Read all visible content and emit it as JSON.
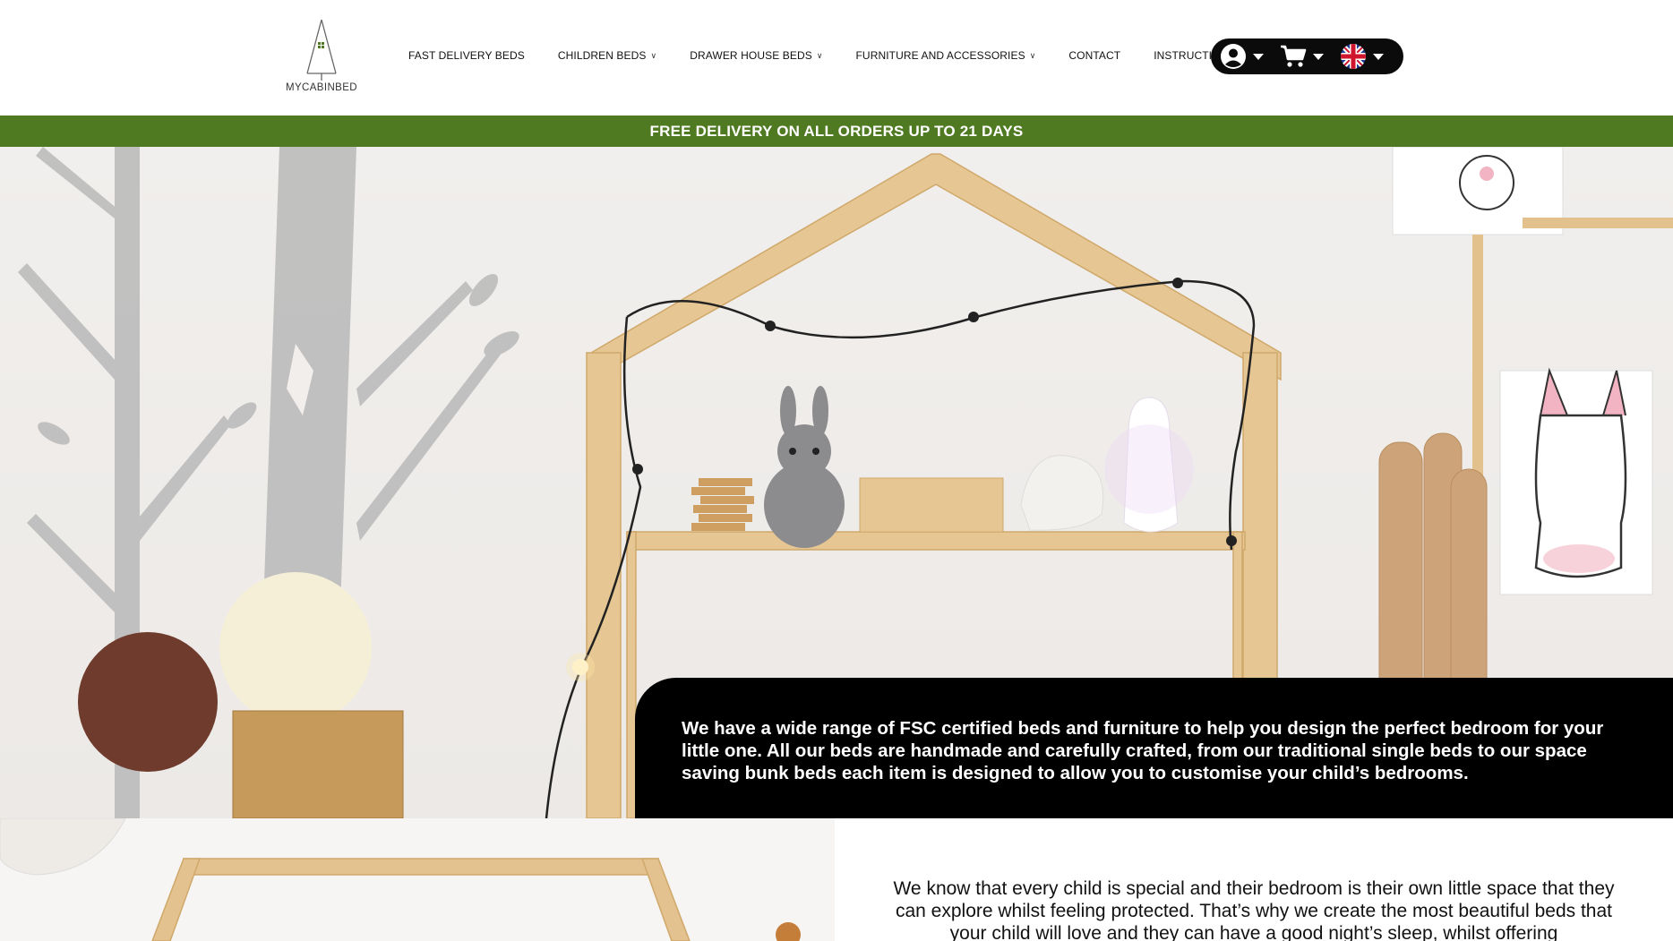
{
  "header": {
    "logo_text": "MYCABINBED",
    "nav": [
      {
        "label": "FAST DELIVERY BEDS",
        "has_dropdown": false
      },
      {
        "label": "CHILDREN BEDS",
        "has_dropdown": true
      },
      {
        "label": "DRAWER HOUSE BEDS",
        "has_dropdown": true
      },
      {
        "label": "FURNITURE AND ACCESSORIES",
        "has_dropdown": true
      },
      {
        "label": "CONTACT",
        "has_dropdown": false
      },
      {
        "label": "INSTRUCTIONS",
        "has_dropdown": false
      }
    ],
    "dropdown_caret": "∨",
    "account_icon": "user-circle-icon",
    "cart_icon": "shopping-cart-icon",
    "language_icon": "uk-flag-icon"
  },
  "promo": {
    "text": "FREE DELIVERY ON ALL ORDERS UP TO 21 DAYS",
    "background": "#4f7a22"
  },
  "hero": {
    "card_text": "We have a wide range of FSC certified beds and furniture to help you design the perfect bedroom for your little one. All our beds are handmade and carefully crafted, from our traditional single beds to our space saving bunk beds each item is designed to allow you to customise your child’s bedrooms."
  },
  "intro": {
    "text": "We know that every child is special and their bedroom is their own little space that they can explore whilst feeling protected. That’s why we create the most beautiful beds that your child will love and they can have a good night’s sleep, whilst offering"
  },
  "colors": {
    "accent_green": "#4f7a22",
    "pill_black": "#0b0b0b",
    "wood": "#e3c290"
  }
}
